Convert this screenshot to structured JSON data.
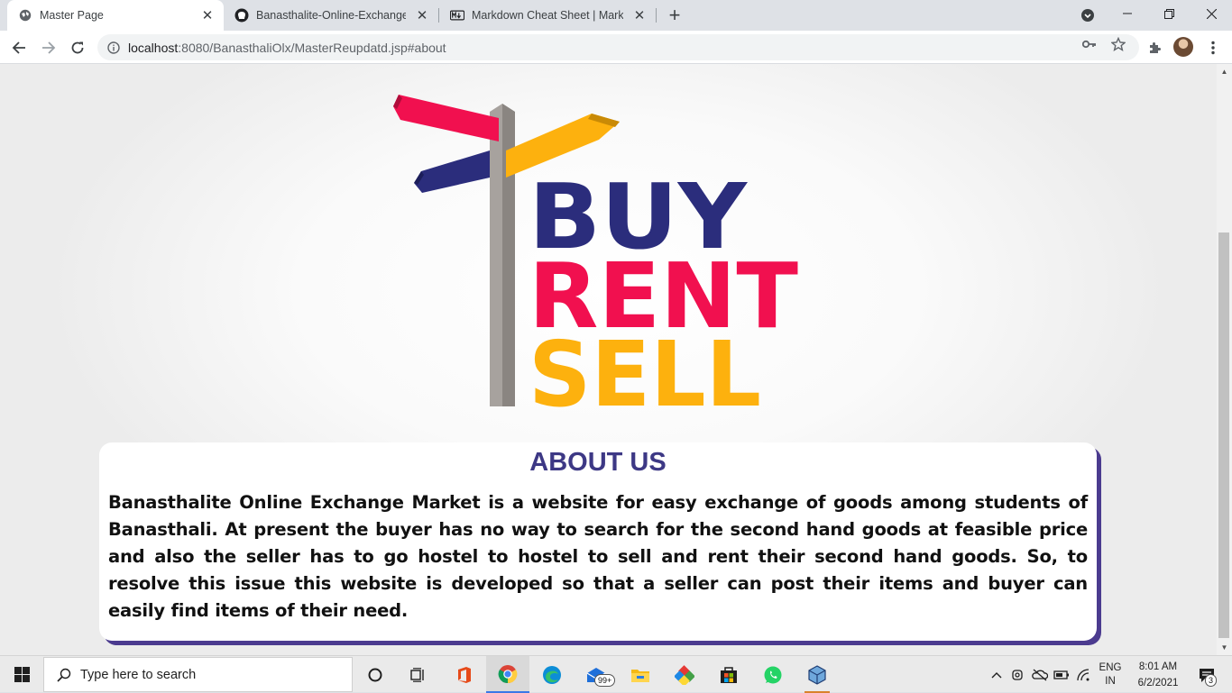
{
  "browser": {
    "tabs": [
      {
        "title": "Master Page",
        "active": true,
        "icon": "globe-icon"
      },
      {
        "title": "Banasthalite-Online-Exchange-M",
        "active": false,
        "icon": "github-icon"
      },
      {
        "title": "Markdown Cheat Sheet | Markdo",
        "active": false,
        "icon": "markdown-icon"
      }
    ],
    "address": {
      "host": "localhost",
      "rest": ":8080/BanasthaliOlx/MasterReupdatd.jsp#about"
    }
  },
  "page": {
    "logo": {
      "line1": "BUY",
      "line2": "RENT",
      "line3": "SELL",
      "colors": {
        "buy": "#2b2d7c",
        "rent": "#f1104f",
        "sell": "#fdb10e"
      }
    },
    "about": {
      "title": "ABOUT US",
      "text": "Banasthalite Online Exchange Market is a website for easy exchange of goods among students of Banasthali. At present the buyer has no way to search for the second hand goods at feasible price and also the seller has to go hostel to hostel to sell and rent their second hand goods. So, to resolve this issue this website is developed so that a seller can post their items and buyer can easily find items of their need."
    }
  },
  "taskbar": {
    "search_placeholder": "Type here to search",
    "mail_badge": "99+",
    "lang_line1": "ENG",
    "lang_line2": "IN",
    "time": "8:01 AM",
    "date": "6/2/2021",
    "notifications": "3"
  }
}
